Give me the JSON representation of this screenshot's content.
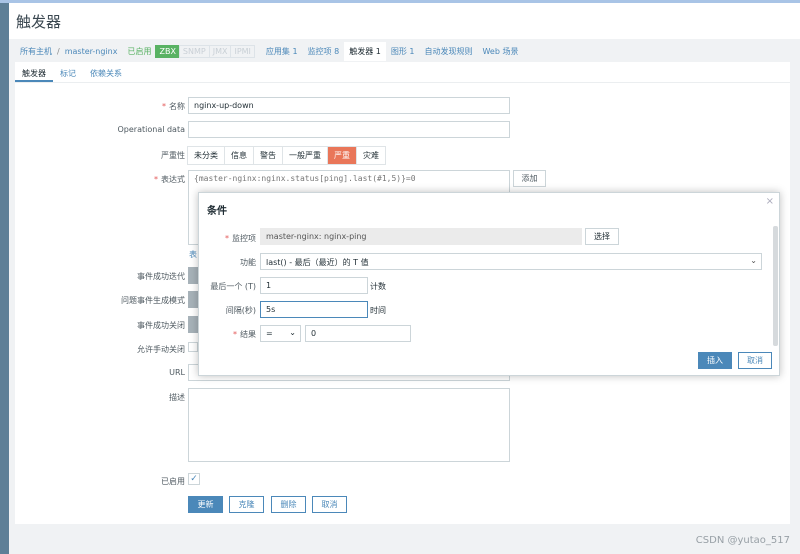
{
  "title": "触发器",
  "breadcrumb": {
    "all_hosts": "所有主机",
    "sep": "/",
    "host": "master-nginx",
    "status": "已启用",
    "tags": [
      "ZBX",
      "SNMP",
      "JMX",
      "IPMI"
    ],
    "links": [
      "应用集 1",
      "监控项 8",
      "触发器 1",
      "图形 1",
      "自动发现规则",
      "Web 场景"
    ]
  },
  "subtabs": [
    "触发器",
    "标记",
    "依赖关系"
  ],
  "form": {
    "name_label": "名称",
    "name_value": "nginx-up-down",
    "opdata_label": "Operational data",
    "opdata_value": "",
    "severity_label": "严重性",
    "severities": [
      "未分类",
      "信息",
      "警告",
      "一般严重",
      "严重",
      "灾难"
    ],
    "expr_label": "表达式",
    "expr_value": "{master-nginx:nginx.status[ping].last(#1,5)}=0",
    "add_button": "添加",
    "expr_link": "表",
    "ok_event_label": "事件成功迭代",
    "problem_mode_label": "问题事件生成模式",
    "ok_close_label": "事件成功关闭",
    "manual_close_label": "允许手动关闭",
    "url_label": "URL",
    "desc_label": "描述",
    "enabled_label": "已启用",
    "buttons": {
      "update": "更新",
      "clone": "克隆",
      "delete": "删除",
      "cancel": "取消"
    }
  },
  "modal": {
    "title": "条件",
    "item_label": "监控项",
    "item_value": "master-nginx: nginx-ping",
    "select_button": "选择",
    "function_label": "功能",
    "function_value": "last() - 最后（最近）的 T 值",
    "last_label": "最后一个 (T)",
    "last_value": "1",
    "last_unit": "计数",
    "interval_label": "间隔(秒)",
    "interval_value": "5s",
    "interval_unit": "时间",
    "result_label": "结果",
    "result_op": "=",
    "result_value": "0",
    "insert_button": "插入",
    "cancel_button": "取消"
  },
  "watermark": "CSDN @yutao_517"
}
